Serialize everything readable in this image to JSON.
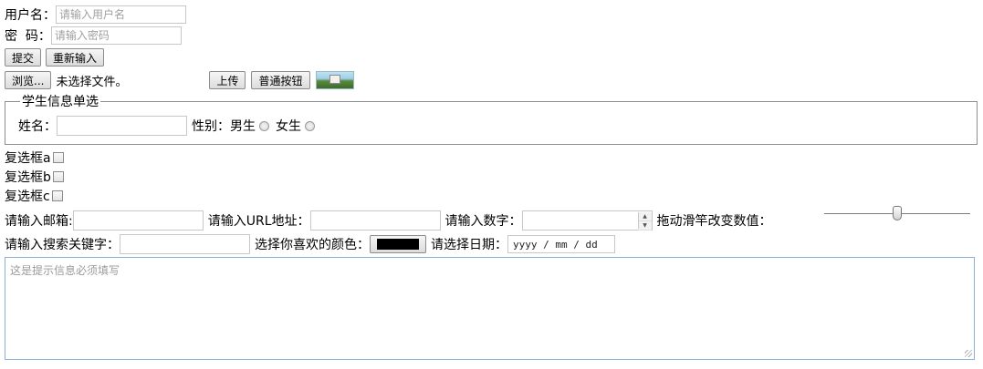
{
  "login": {
    "username_label": "用户名：",
    "username_placeholder": "请输入用户名",
    "password_label": "密  码：",
    "password_placeholder": "请输入密码",
    "submit_label": "提交",
    "reset_label": "重新输入"
  },
  "file": {
    "browse_label": "浏览...",
    "no_file_text": "未选择文件。",
    "upload_label": "上传",
    "normal_button_label": "普通按钮"
  },
  "fieldset": {
    "legend": "学生信息单选",
    "name_label": "姓名：",
    "gender_label": "性别：",
    "male_label": "男生",
    "female_label": "女生"
  },
  "checkboxes": [
    {
      "label": "复选框a"
    },
    {
      "label": "复选框b"
    },
    {
      "label": "复选框c"
    }
  ],
  "inputs": {
    "email_label": "请输入邮箱:",
    "url_label": "请输入URL地址：",
    "number_label": "请输入数字：",
    "range_label": "拖动滑竿改变数值：",
    "range_value": 0.5,
    "search_label": "请输入搜索关键字：",
    "color_label": "选择你喜欢的颜色：",
    "color_value": "#000000",
    "date_label": "请选择日期：",
    "date_placeholder": "yyyy / mm / dd"
  },
  "textarea": {
    "placeholder": "这是提示信息必须填写"
  }
}
